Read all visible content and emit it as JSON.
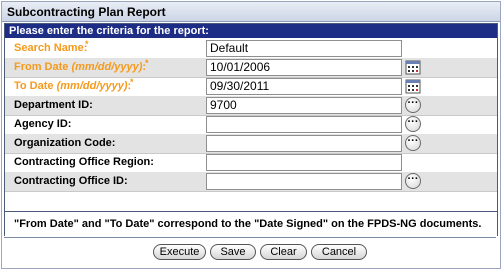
{
  "window": {
    "title": "Subcontracting Plan Report"
  },
  "form": {
    "header": "Please enter the criteria for the report:",
    "fields": {
      "search_name": {
        "label": "Search Name:",
        "value": "Default"
      },
      "from_date": {
        "label": "From Date",
        "format_hint": "(mm/dd/yyyy)",
        "value": "10/01/2006"
      },
      "to_date": {
        "label": "To Date",
        "format_hint": "(mm/dd/yyyy)",
        "value": "09/30/2011"
      },
      "department_id": {
        "label": "Department ID:",
        "value": "9700"
      },
      "agency_id": {
        "label": "Agency ID:",
        "value": ""
      },
      "organization_code": {
        "label": "Organization Code:",
        "value": ""
      },
      "contracting_office_region": {
        "label": "Contracting Office Region:",
        "value": ""
      },
      "contracting_office_id": {
        "label": "Contracting Office ID:",
        "value": ""
      }
    },
    "note": "\"From Date\" and \"To Date\" correspond to the \"Date Signed\" on the FPDS-NG documents."
  },
  "buttons": {
    "execute": "Execute",
    "save": "Save",
    "clear": "Clear",
    "cancel": "Cancel"
  },
  "colors": {
    "header_bg": "#1d2c85",
    "required_label": "#f59a1c",
    "alt_row_bg": "#e3e3e3"
  }
}
